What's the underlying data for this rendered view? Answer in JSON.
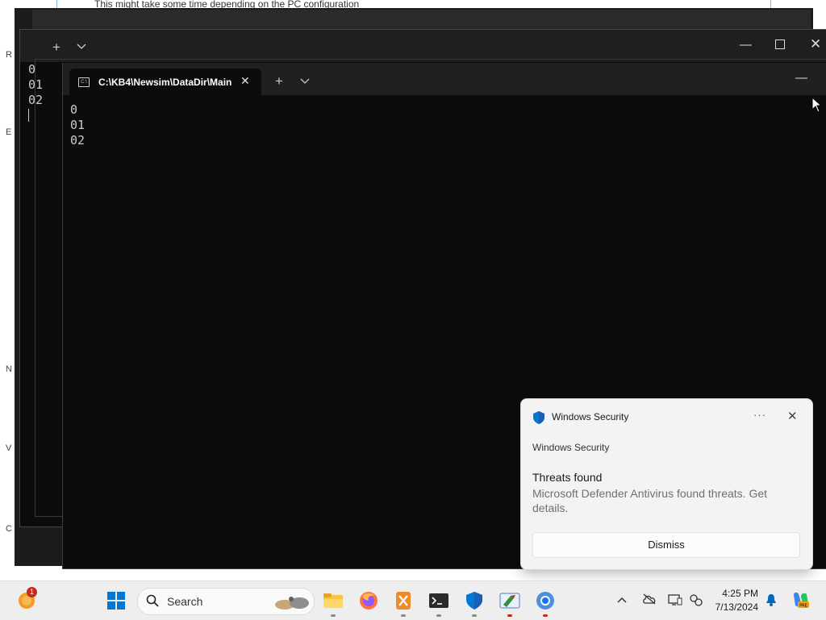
{
  "background_doc": {
    "partial_text": "This might take some time depending on the PC configuration"
  },
  "left_edge_glyphs": [
    "R",
    "E",
    "N",
    "V",
    "C"
  ],
  "terminal_back": {
    "output_lines": [
      "0",
      "01",
      "02"
    ],
    "new_tab_label": "+",
    "dropdown_label": "⌄",
    "minimize_label": "—",
    "close_label": "✕"
  },
  "terminal_front": {
    "tab_title": "C:\\KB4\\Newsim\\DataDir\\Main",
    "tab_icon_text": "C:\\",
    "tab_close_label": "✕",
    "new_tab_label": "+",
    "dropdown_label": "⌄",
    "minimize_label": "—",
    "output_lines": [
      "0",
      "01",
      "02"
    ]
  },
  "notification": {
    "app_name": "Windows Security",
    "more_label": "···",
    "close_label": "✕",
    "source": "Windows Security",
    "title": "Threats found",
    "body": "Microsoft Defender Antivirus found threats. Get details.",
    "dismiss_label": "Dismiss"
  },
  "taskbar": {
    "weather_badge": "1",
    "search_placeholder": "Search",
    "apps": [
      {
        "name": "start-menu-icon"
      },
      {
        "name": "file-explorer-icon"
      },
      {
        "name": "firefox-icon"
      },
      {
        "name": "app-x-icon"
      },
      {
        "name": "terminal-icon"
      },
      {
        "name": "windows-security-icon"
      },
      {
        "name": "pen-app-icon"
      },
      {
        "name": "chrome-icon"
      }
    ],
    "tray_chevron": "^",
    "clock_time": "4:25 PM",
    "clock_date": "7/13/2024"
  },
  "colors": {
    "terminal_bg": "#0c0c0c",
    "tabbar_bg": "#202020",
    "accent_blue": "#0078d4",
    "alert_red": "#c42b1c"
  }
}
